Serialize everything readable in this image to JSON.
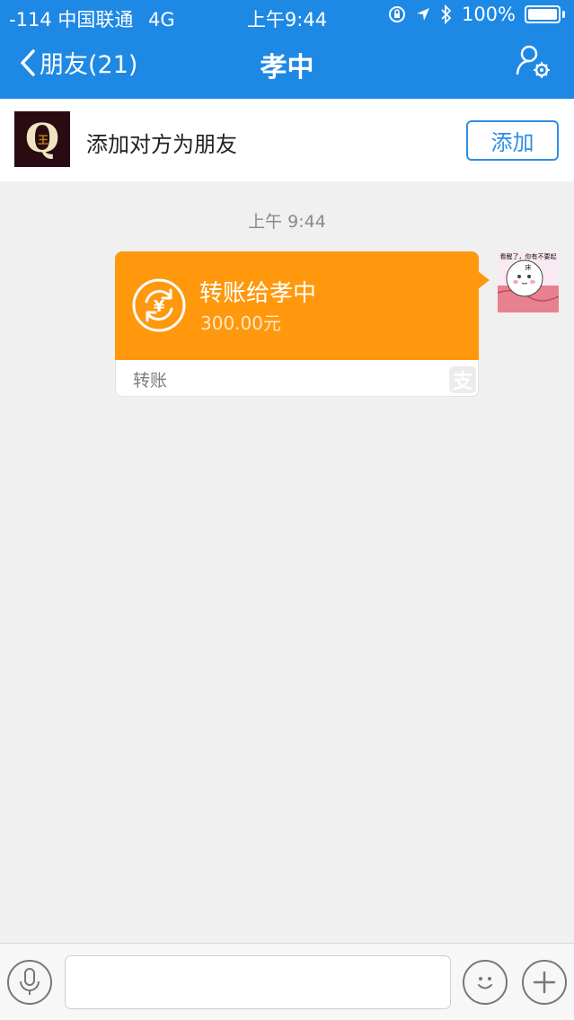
{
  "status_bar": {
    "signal": "-114 中国联通",
    "network": "4G",
    "time": "上午9:44",
    "battery": "100%"
  },
  "nav": {
    "back_label": "朋友(21)",
    "title": "孝中"
  },
  "add_friend": {
    "prompt": "添加对方为朋友",
    "button": "添加",
    "avatar_letter": "Q",
    "avatar_badge": "王"
  },
  "chat": {
    "timestamp": "上午 9:44",
    "messages": [
      {
        "type": "transfer",
        "title": "转账给孝中",
        "amount": "300.00元",
        "footer": "转账"
      }
    ],
    "my_avatar_caption": "看醒了，你有不要起床"
  },
  "input": {
    "placeholder": ""
  },
  "colors": {
    "nav_blue": "#1e88e5",
    "transfer_orange": "#ff980c",
    "button_blue": "#2d8ee7"
  },
  "icons": {
    "back": "chevron-left-icon",
    "profile_settings": "person-settings-icon",
    "transfer": "yuan-exchange-icon",
    "alipay": "alipay-icon",
    "voice": "microphone-icon",
    "emoji": "smiley-icon",
    "plus": "plus-icon"
  }
}
